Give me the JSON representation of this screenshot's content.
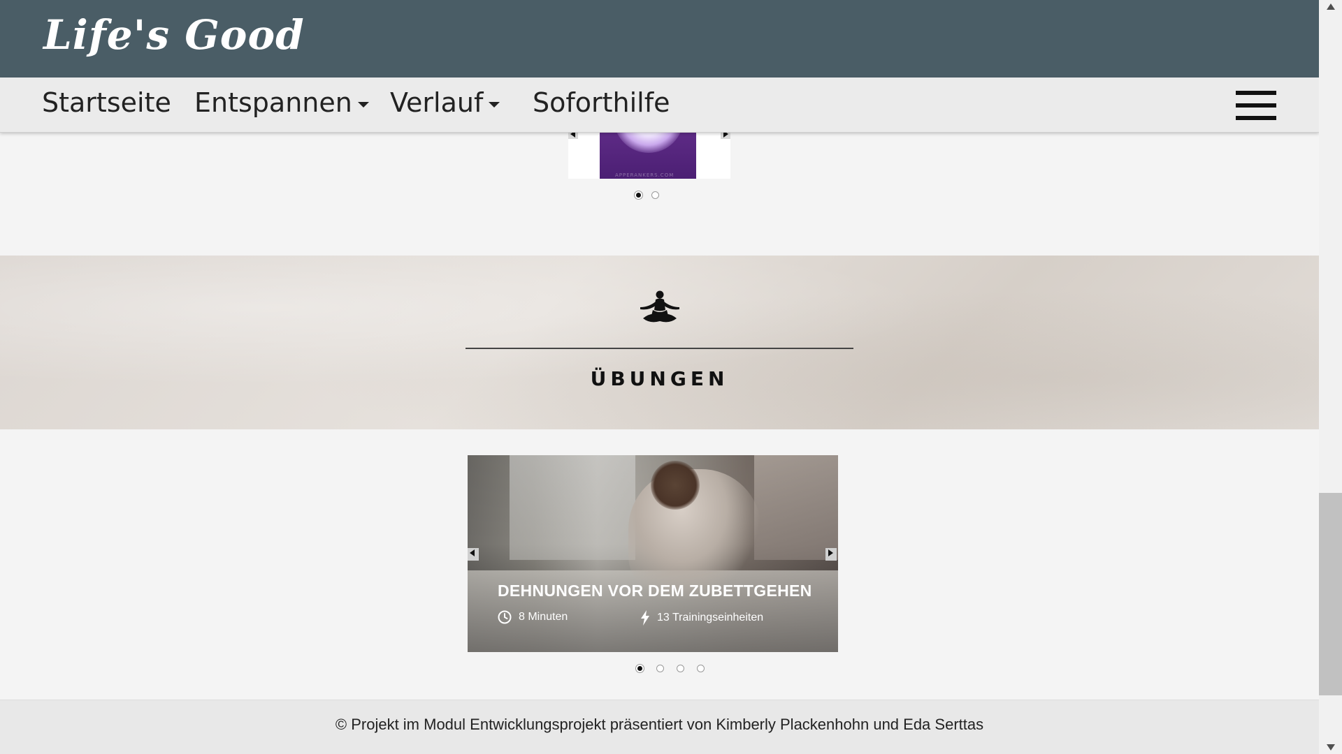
{
  "header": {
    "logo": "Life's Good"
  },
  "nav": {
    "items": [
      {
        "label": "Startseite",
        "has_dropdown": false
      },
      {
        "label": "Entspannen",
        "has_dropdown": true
      },
      {
        "label": "Verlauf",
        "has_dropdown": true
      },
      {
        "label": "Soforthilfe",
        "has_dropdown": false
      }
    ],
    "menu_icon": "hamburger-menu-icon"
  },
  "top_carousel": {
    "image_watermark": "APPERANKERS.COM",
    "slide_count": 2,
    "active_index": 0
  },
  "exercises_section": {
    "icon": "meditation-pose-icon",
    "title": "ÜBUNGEN"
  },
  "exercise_carousel": {
    "title": "DEHNUNGEN VOR DEM ZUBETTGEHEN",
    "duration": "8 Minuten",
    "duration_icon": "clock-icon",
    "sessions": "13 Trainingseinheiten",
    "sessions_icon": "lightning-bolt-icon",
    "slide_count": 4,
    "active_index": 0
  },
  "footer": {
    "text": "© Projekt im Modul Entwicklungsprojekt präsentiert von Kimberly Plackenhohn und Eda Serttas"
  }
}
